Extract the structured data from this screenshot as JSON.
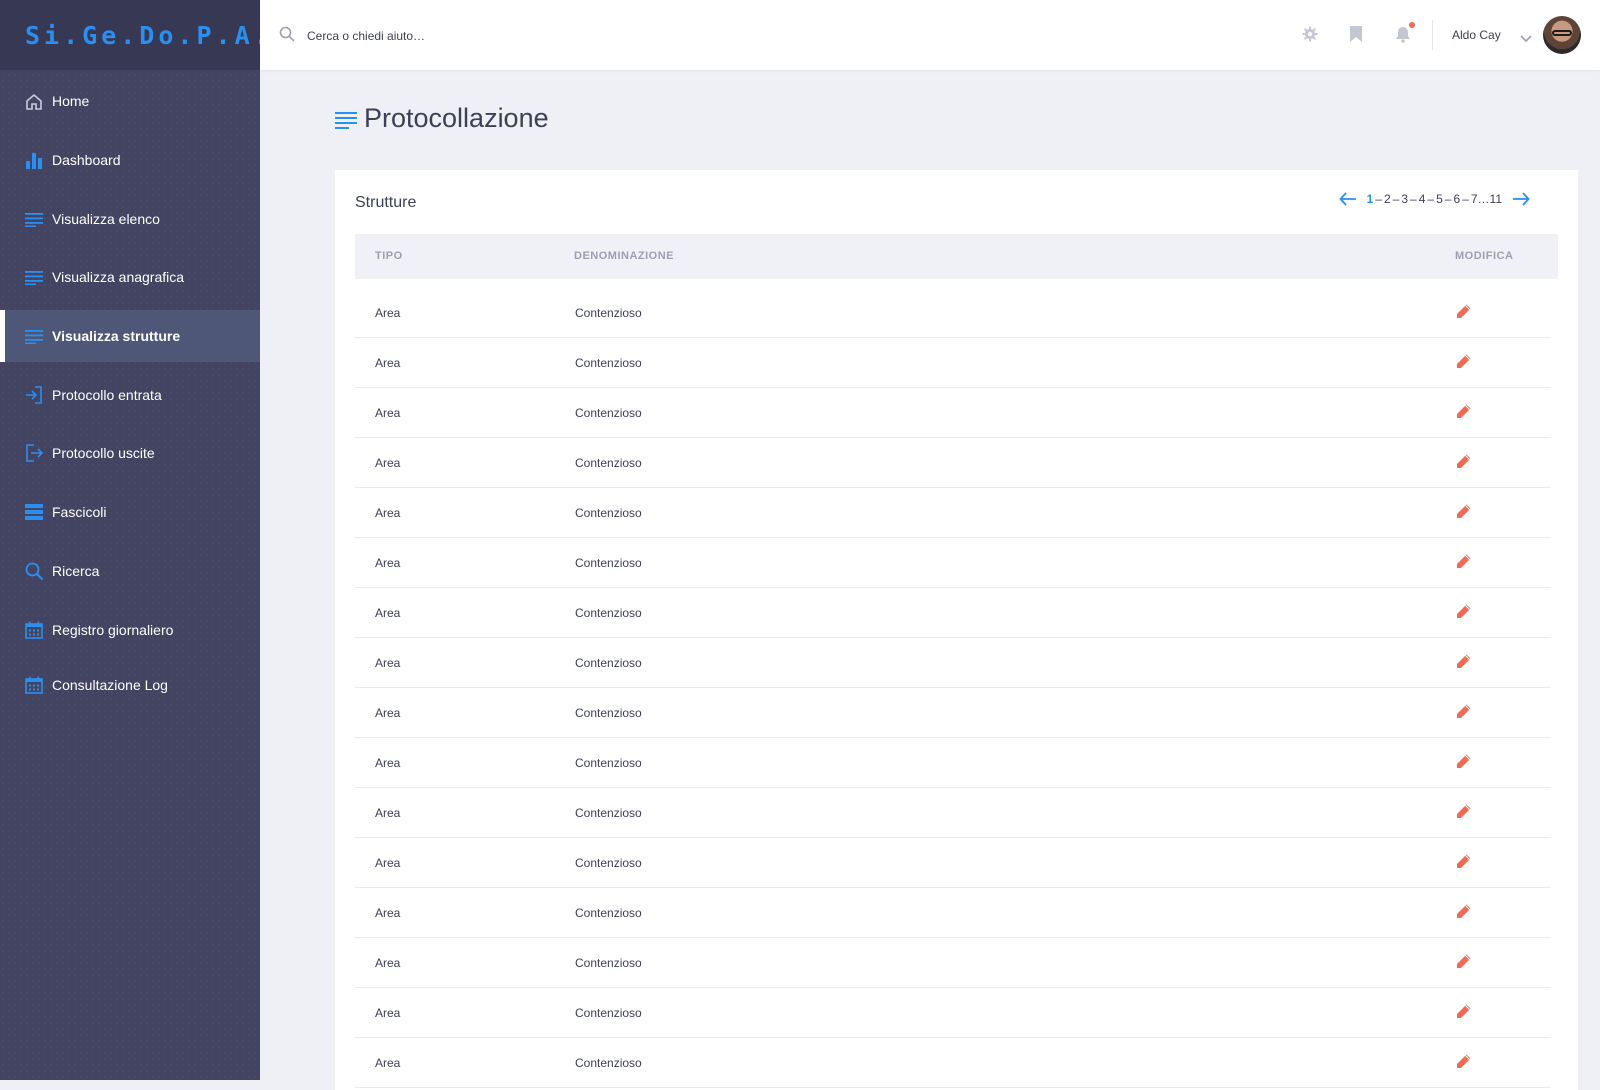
{
  "brand": "Si.Ge.Do.P.A.",
  "colors": {
    "accent": "#2b8ff2",
    "sidebar": "#424461",
    "edit": "#f36a54"
  },
  "sidebar": {
    "items": [
      {
        "label": "Home",
        "icon": "home-icon"
      },
      {
        "label": "Dashboard",
        "icon": "bar-chart-icon"
      },
      {
        "label": "Visualizza elenco",
        "icon": "list-icon"
      },
      {
        "label": "Visualizza anagrafica",
        "icon": "list-icon"
      },
      {
        "label": "Visualizza strutture",
        "icon": "list-icon",
        "active": true
      },
      {
        "label": "Protocollo entrata",
        "icon": "sign-in-icon"
      },
      {
        "label": "Protocollo uscite",
        "icon": "sign-out-icon"
      },
      {
        "label": "Fascicoli",
        "icon": "stack-icon"
      },
      {
        "label": "Ricerca",
        "icon": "search-icon"
      },
      {
        "label": "Registro giornaliero",
        "icon": "calendar-icon"
      },
      {
        "label": "Consultazione Log",
        "icon": "calendar-icon"
      }
    ]
  },
  "topbar": {
    "search_placeholder": "Cerca o chiedi aiuto…",
    "user_name": "Aldo Cay",
    "icons": [
      "gear-icon",
      "bookmark-icon",
      "bell-icon"
    ]
  },
  "page": {
    "title": "Protocollazione"
  },
  "card": {
    "title": "Strutture",
    "pagination": {
      "pages": [
        "1",
        "2",
        "3",
        "4",
        "5",
        "6",
        "7"
      ],
      "ellipsis": "…",
      "last": "11",
      "current": "1"
    },
    "columns": {
      "tipo": "TIPO",
      "denominazione": "DENOMINAZIONE",
      "modifica": "MODIFICA"
    },
    "rows": [
      {
        "tipo": "Area",
        "denominazione": "Contenzioso"
      },
      {
        "tipo": "Area",
        "denominazione": "Contenzioso"
      },
      {
        "tipo": "Area",
        "denominazione": "Contenzioso"
      },
      {
        "tipo": "Area",
        "denominazione": "Contenzioso"
      },
      {
        "tipo": "Area",
        "denominazione": "Contenzioso"
      },
      {
        "tipo": "Area",
        "denominazione": "Contenzioso"
      },
      {
        "tipo": "Area",
        "denominazione": "Contenzioso"
      },
      {
        "tipo": "Area",
        "denominazione": "Contenzioso"
      },
      {
        "tipo": "Area",
        "denominazione": "Contenzioso"
      },
      {
        "tipo": "Area",
        "denominazione": "Contenzioso"
      },
      {
        "tipo": "Area",
        "denominazione": "Contenzioso"
      },
      {
        "tipo": "Area",
        "denominazione": "Contenzioso"
      },
      {
        "tipo": "Area",
        "denominazione": "Contenzioso"
      },
      {
        "tipo": "Area",
        "denominazione": "Contenzioso"
      },
      {
        "tipo": "Area",
        "denominazione": "Contenzioso"
      },
      {
        "tipo": "Area",
        "denominazione": "Contenzioso"
      }
    ]
  }
}
